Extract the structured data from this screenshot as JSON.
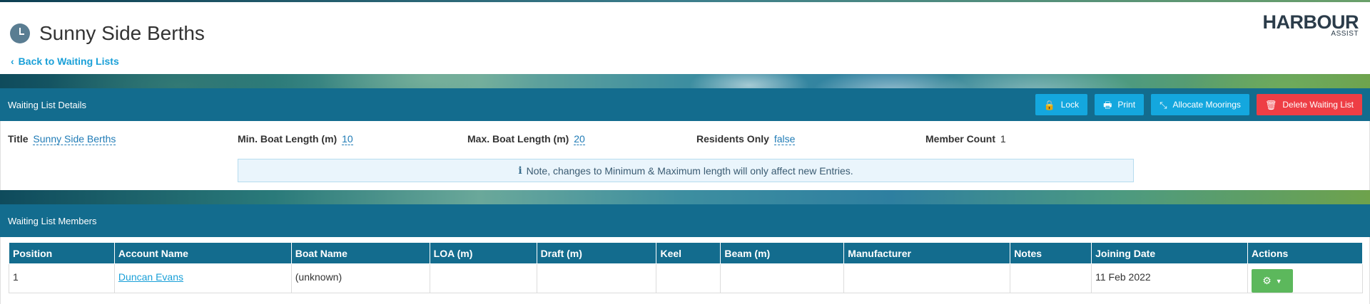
{
  "header": {
    "title": "Sunny Side Berths",
    "back_link": "Back to Waiting Lists",
    "logo_main": "HARBOUR",
    "logo_sub": "ASSIST"
  },
  "details_panel": {
    "heading": "Waiting List Details",
    "buttons": {
      "lock": "Lock",
      "print": "Print",
      "allocate": "Allocate Moorings",
      "delete": "Delete Waiting List"
    },
    "fields": {
      "title_label": "Title",
      "title_value": "Sunny Side Berths",
      "min_label": "Min. Boat Length (m)",
      "min_value": "10",
      "max_label": "Max. Boat Length (m)",
      "max_value": "20",
      "residents_label": "Residents Only",
      "residents_value": "false",
      "count_label": "Member Count",
      "count_value": "1"
    },
    "note": "Note, changes to Minimum & Maximum length will only affect new Entries."
  },
  "members_panel": {
    "heading": "Waiting List Members",
    "columns": [
      "Position",
      "Account Name",
      "Boat Name",
      "LOA (m)",
      "Draft (m)",
      "Keel",
      "Beam (m)",
      "Manufacturer",
      "Notes",
      "Joining Date",
      "Actions"
    ],
    "rows": [
      {
        "position": "1",
        "account_name": "Duncan Evans",
        "boat_name": "(unknown)",
        "loa": "",
        "draft": "",
        "keel": "",
        "beam": "",
        "manufacturer": "",
        "notes": "",
        "joining_date": "11 Feb 2022"
      }
    ]
  },
  "colors": {
    "panel_header": "#136c8e",
    "info_button": "#14a7de",
    "danger_button": "#ee3e45",
    "success_button": "#5cb85c",
    "link": "#1aa0d8"
  },
  "icons": [
    "clock-icon",
    "chevron-left-icon",
    "lock-icon",
    "print-icon",
    "allocate-icon",
    "trash-icon",
    "info-icon",
    "gear-icon",
    "caret-down-icon"
  ]
}
